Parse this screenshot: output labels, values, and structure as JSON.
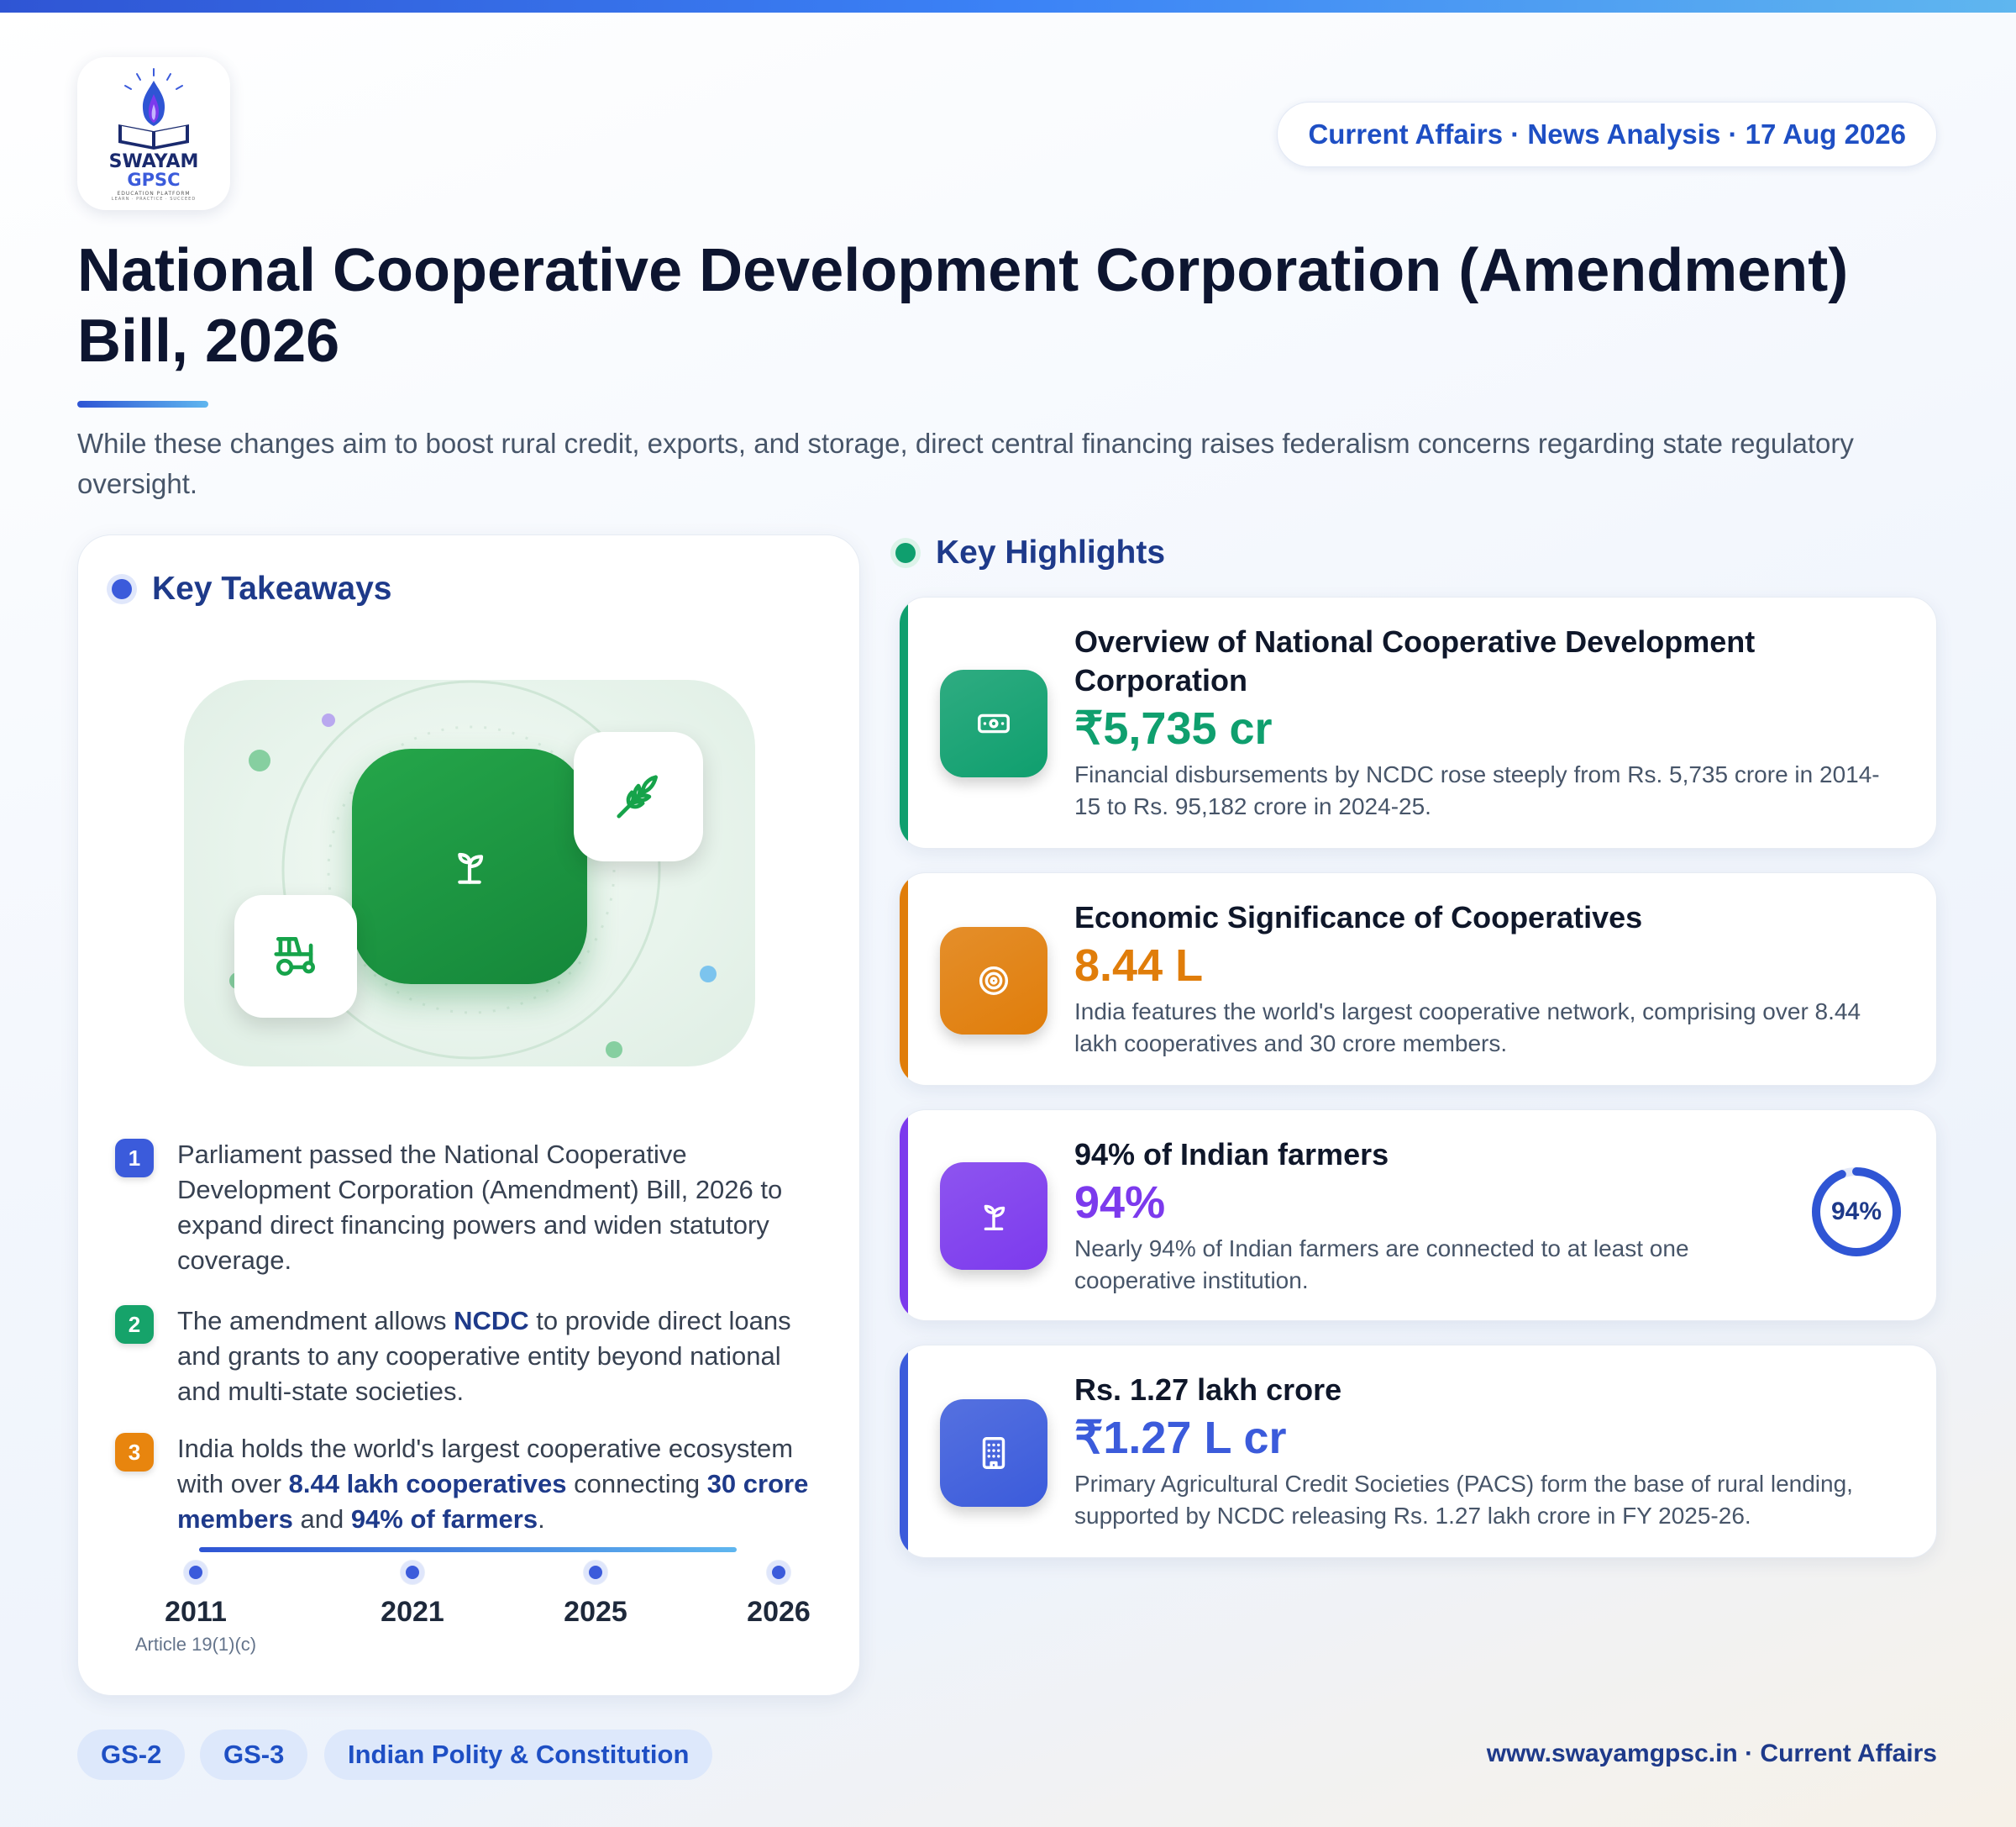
{
  "header": {
    "logo": {
      "line1": "SWAYAM",
      "line2": "GPSC",
      "line3": "EDUCATION PLATFORM",
      "line4": "LEARN · PRACTICE · SUCCEED"
    },
    "date_pill": "Current Affairs · News Analysis · 17 Aug 2026"
  },
  "title": "National Cooperative Development Corporation (Amendment) Bill, 2026",
  "subtitle": "While these changes aim to boost rural credit, exports, and storage, direct central financing raises federalism concerns regarding state regulatory oversight.",
  "takeaways": {
    "heading": "Key Takeaways",
    "items": [
      {
        "num": "1",
        "color": "#3b5bdb",
        "parts": [
          {
            "t": "Parliament passed the National Cooperative Development Corporation (Amendment) Bill, 2026 to expand direct financing powers and widen statutory coverage.",
            "b": false
          }
        ]
      },
      {
        "num": "2",
        "color": "#16a36a",
        "parts": [
          {
            "t": "The amendment allows ",
            "b": false
          },
          {
            "t": "NCDC",
            "b": true
          },
          {
            "t": " to provide direct loans and grants to any cooperative entity beyond national and multi-state societies.",
            "b": false
          }
        ]
      },
      {
        "num": "3",
        "color": "#e8850e",
        "parts": [
          {
            "t": "India holds the world's largest cooperative ecosystem with over ",
            "b": false
          },
          {
            "t": "8.44 lakh cooperatives",
            "b": true
          },
          {
            "t": " connecting ",
            "b": false
          },
          {
            "t": "30 crore members",
            "b": true
          },
          {
            "t": " and ",
            "b": false
          },
          {
            "t": "94% of farmers",
            "b": true
          },
          {
            "t": ".",
            "b": false
          }
        ]
      }
    ],
    "timeline": [
      {
        "year": "2011",
        "note": "Article 19(1)(c)"
      },
      {
        "year": "2021",
        "note": ""
      },
      {
        "year": "2025",
        "note": ""
      },
      {
        "year": "2026",
        "note": ""
      }
    ]
  },
  "highlights": {
    "heading": "Key Highlights",
    "cards": [
      {
        "title": "Overview of National Cooperative Development Corporation",
        "value": "₹5,735 cr",
        "desc": "Financial disbursements by NCDC rose steeply from Rs. 5,735 crore in 2014-15 to Rs. 95,182 crore in 2024-25.",
        "accent": "#0f9f6e",
        "icon": "banknote-icon"
      },
      {
        "title": "Economic Significance of Cooperatives",
        "value": "8.44 L",
        "desc": "India features the world's largest cooperative network, comprising over 8.44 lakh cooperatives and 30 crore members.",
        "accent": "#e07d0a",
        "icon": "target-icon"
      },
      {
        "title": "94% of Indian farmers",
        "value": "94%",
        "desc": "Nearly 94% of Indian farmers are connected to at least one cooperative institution.",
        "accent": "#7c3aed",
        "icon": "sprout-icon",
        "gauge_label": "94%",
        "gauge_fraction": 0.94
      },
      {
        "title": "Rs. 1.27 lakh crore",
        "value": "₹1.27 L cr",
        "desc": "Primary Agricultural Credit Societies (PACS) form the base of rural lending, supported by NCDC releasing Rs. 1.27 lakh crore in FY 2025-26.",
        "accent": "#3b5bdb",
        "icon": "building-icon"
      }
    ]
  },
  "tags": [
    "GS-2",
    "GS-3",
    "Indian Polity & Constitution"
  ],
  "footer": "www.swayamgpsc.in · Current Affairs"
}
